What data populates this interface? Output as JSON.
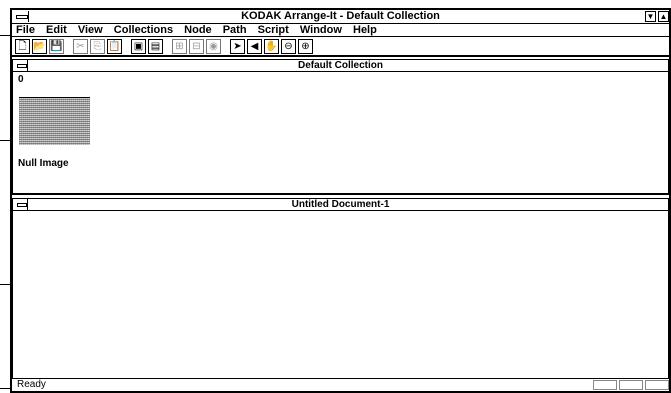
{
  "window": {
    "title": "KODAK Arrange-It - Default Collection"
  },
  "menu": [
    "File",
    "Edit",
    "View",
    "Collections",
    "Node",
    "Path",
    "Script",
    "Window",
    "Help"
  ],
  "toolbar": {
    "tools": [
      {
        "name": "new",
        "glyph": "🗋"
      },
      {
        "name": "open",
        "glyph": "📂"
      },
      {
        "name": "save",
        "glyph": "💾"
      },
      {
        "name": "cut",
        "glyph": "✂"
      },
      {
        "name": "copy",
        "glyph": "⎘"
      },
      {
        "name": "paste",
        "glyph": "📋"
      },
      {
        "name": "node-a",
        "glyph": "▣"
      },
      {
        "name": "node-b",
        "glyph": "▤"
      },
      {
        "name": "layout-a",
        "glyph": "⊞"
      },
      {
        "name": "layout-b",
        "glyph": "⊟"
      },
      {
        "name": "view",
        "glyph": "◉"
      },
      {
        "name": "pointer",
        "glyph": "➤"
      },
      {
        "name": "sound",
        "glyph": "◀"
      },
      {
        "name": "hand",
        "glyph": "✋"
      },
      {
        "name": "zoom-out",
        "glyph": "⊖"
      },
      {
        "name": "zoom-in",
        "glyph": "⊕"
      }
    ]
  },
  "collection": {
    "title": "Default Collection",
    "counter": "0",
    "item_label": "Null Image"
  },
  "document": {
    "title": "Untitled Document-1"
  },
  "status": {
    "text": "Ready"
  }
}
